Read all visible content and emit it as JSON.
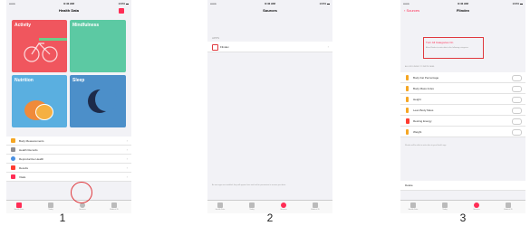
{
  "panels": [
    {
      "number": "1",
      "status": {
        "carrier": "•••oo",
        "time": "9:41 AM",
        "battery": "100% ▬"
      },
      "title": "Health Data",
      "tiles": [
        {
          "label": "Activity",
          "color": "#f0565e"
        },
        {
          "label": "Mindfulness",
          "color": "#5cc9a3"
        },
        {
          "label": "Nutrition",
          "color": "#5aafe0"
        },
        {
          "label": "Sleep",
          "color": "#4c8fc9"
        }
      ],
      "rows": [
        {
          "label": "Body Measurements",
          "icon_color": "#f5a623"
        },
        {
          "label": "Health Records",
          "icon_color": "#8e8e93"
        },
        {
          "label": "Reproductive Health",
          "icon_color": "#4a90e2"
        },
        {
          "label": "Results",
          "icon_color": "#ff3b30"
        },
        {
          "label": "Vitals",
          "icon_color": "#ff2d55"
        }
      ],
      "tabs": [
        "Health Data",
        "Today",
        "Sources",
        "Medical ID"
      ]
    },
    {
      "number": "2",
      "status": {
        "carrier": "•••oo",
        "time": "9:41 AM",
        "battery": "100% ▬"
      },
      "title": "Sources",
      "section": "APPS",
      "app_name": "Flindex",
      "footer": "As new apps are installed, they will appear here and ask for permission to access your data.",
      "tabs": [
        "Health Data",
        "Today",
        "Sources",
        "Medical ID"
      ]
    },
    {
      "number": "3",
      "status": {
        "carrier": "•••oo",
        "time": "9:41 AM",
        "battery": "100% ▬"
      },
      "back": "‹ Sources",
      "title": "Flindex",
      "header_line": "Turn All Categories On",
      "desc": "Allow Flindex to write data to the following categories",
      "section": "ALLOW FLINDEX TO WRITE DATA:",
      "items": [
        "Body Fat Percentage",
        "Body Mass Index",
        "Height",
        "Lean Body Mass",
        "Resting Energy",
        "Weight"
      ],
      "note": "Flindex will be able to write data to your Health app.",
      "delete_label": "Delete",
      "tabs": [
        "Health Data",
        "Today",
        "Sources",
        "Medical ID"
      ]
    }
  ]
}
